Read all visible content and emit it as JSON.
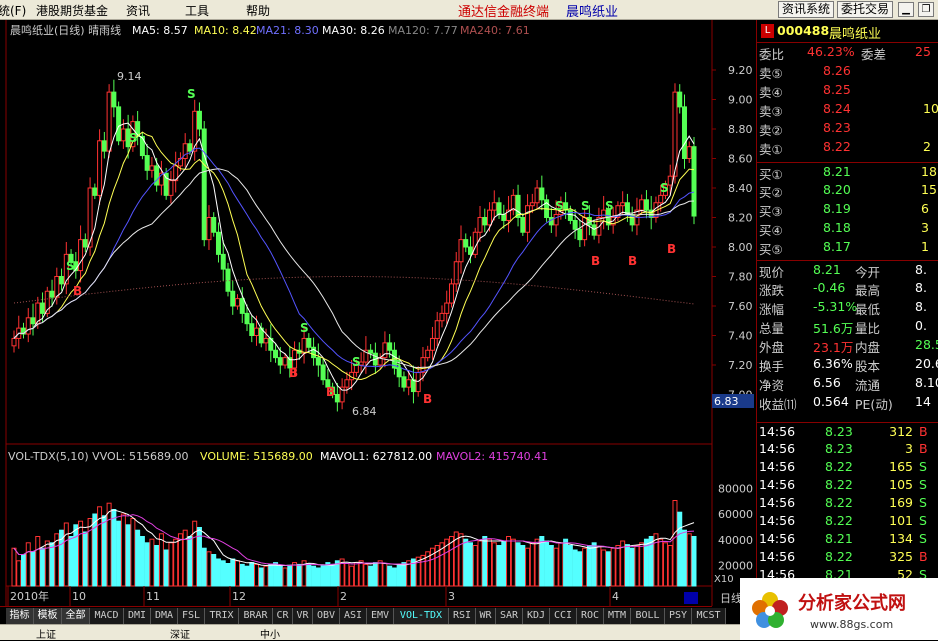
{
  "menu": {
    "item1": "系统(F)",
    "item2": "港股期货基金",
    "item3": "资讯",
    "item4": "工具",
    "item5": "帮助",
    "item6": "通达信金融终端",
    "item7": "晨鸣纸业",
    "btn1": "资讯系统",
    "btn2": "委托交易"
  },
  "chart": {
    "title": "晨鸣纸业(日线) 晴雨线",
    "ma5": "MA5: 8.57",
    "ma10": "MA10: 8.42",
    "ma21": "MA21: 8.30",
    "ma30": "MA30: 8.26",
    "ma120": "MA120: 7.77",
    "ma240": "MA240: 7.61",
    "high_label": "9.14",
    "low_label": "6.84",
    "price_tag": "6.83",
    "price_ticks": [
      "9.20",
      "9.00",
      "8.80",
      "8.60",
      "8.40",
      "8.20",
      "8.00",
      "7.80",
      "7.60",
      "7.40",
      "7.20",
      "7.00"
    ],
    "vol_line": "VOL-TDX(5,10) VVOL: 515689.00",
    "vol_volume": "VOLUME: 515689.00",
    "vol_mavol1": "MAVOL1: 627812.00",
    "vol_mavol2": "MAVOL2: 415740.41",
    "vol_ticks": [
      "80000",
      "60000",
      "40000",
      "20000"
    ],
    "vol_unit": "X10",
    "x_labels": [
      "2010年",
      "10",
      "11",
      "12",
      "2",
      "3",
      "4"
    ],
    "ri_label": "日线"
  },
  "quote": {
    "code": "000488",
    "name": "晨鸣纸业",
    "badge": "L",
    "weibi_label": "委比",
    "weibi": "46.23%",
    "weicha_label": "委差",
    "weicha": "25",
    "asks": [
      {
        "label": "卖⑤",
        "price": "8.26",
        "vol": ""
      },
      {
        "label": "卖④",
        "price": "8.25",
        "vol": ""
      },
      {
        "label": "卖③",
        "price": "8.24",
        "vol": "10"
      },
      {
        "label": "卖②",
        "price": "8.23",
        "vol": ""
      },
      {
        "label": "卖①",
        "price": "8.22",
        "vol": "2"
      }
    ],
    "bids": [
      {
        "label": "买①",
        "price": "8.21",
        "vol": "18"
      },
      {
        "label": "买②",
        "price": "8.20",
        "vol": "15"
      },
      {
        "label": "买③",
        "price": "8.19",
        "vol": "6"
      },
      {
        "label": "买④",
        "price": "8.18",
        "vol": "3"
      },
      {
        "label": "买⑤",
        "price": "8.17",
        "vol": "1"
      }
    ],
    "stats": [
      {
        "l1": "现价",
        "v1": "8.21",
        "l2": "今开",
        "v2": "8."
      },
      {
        "l1": "涨跌",
        "v1": "-0.46",
        "l2": "最高",
        "v2": "8."
      },
      {
        "l1": "涨幅",
        "v1": "-5.31%",
        "l2": "最低",
        "v2": "8."
      },
      {
        "l1": "总量",
        "v1": "51.6万",
        "l2": "量比",
        "v2": "0."
      },
      {
        "l1": "外盘",
        "v1": "23.1万",
        "l2": "内盘",
        "v2": "28.5"
      },
      {
        "l1": "换手",
        "v1": "6.36%",
        "l2": "股本",
        "v2": "20.6"
      },
      {
        "l1": "净资",
        "v1": "6.56",
        "l2": "流通",
        "v2": "8.10"
      },
      {
        "l1": "收益⑾",
        "v1": "0.564",
        "l2": "PE(动)",
        "v2": "14"
      }
    ],
    "ticks": [
      {
        "t": "14:56",
        "p": "8.23",
        "v": "312",
        "d": "B"
      },
      {
        "t": "14:56",
        "p": "8.23",
        "v": "3",
        "d": "B"
      },
      {
        "t": "14:56",
        "p": "8.22",
        "v": "165",
        "d": "S"
      },
      {
        "t": "14:56",
        "p": "8.22",
        "v": "105",
        "d": "S"
      },
      {
        "t": "14:56",
        "p": "8.22",
        "v": "169",
        "d": "S"
      },
      {
        "t": "14:56",
        "p": "8.22",
        "v": "101",
        "d": "S"
      },
      {
        "t": "14:56",
        "p": "8.21",
        "v": "134",
        "d": "S"
      },
      {
        "t": "14:56",
        "p": "8.22",
        "v": "325",
        "d": "B"
      },
      {
        "t": "14:56",
        "p": "8.21",
        "v": "52",
        "d": "S"
      }
    ]
  },
  "tabs": [
    "指标",
    "模板",
    "全部",
    "MACD",
    "DMI",
    "DMA",
    "FSL",
    "TRIX",
    "BRAR",
    "CR",
    "VR",
    "OBV",
    "ASI",
    "EMV",
    "VOL-TDX",
    "RSI",
    "WR",
    "SAR",
    "KDJ",
    "CCI",
    "ROC",
    "MTM",
    "BOLL",
    "PSY",
    "MCST"
  ],
  "status": {
    "s1": "上证",
    "s2": "深证",
    "s3": "中小"
  },
  "logo": {
    "text": "分析家公式网",
    "url": "www.88gs.com"
  },
  "colors": {
    "up": "#ff3232",
    "down": "#54ff54",
    "accent": "#ffff00",
    "ma10": "#ffff54",
    "ma21": "#5454ff",
    "vol_up": "#c00000",
    "vol_down": "#54ffff"
  },
  "chart_data": {
    "type": "candlestick",
    "ylim": [
      6.8,
      9.3
    ],
    "closes": [
      7.38,
      7.45,
      7.41,
      7.52,
      7.48,
      7.62,
      7.55,
      7.7,
      7.66,
      7.8,
      7.75,
      7.95,
      7.9,
      7.84,
      8.05,
      8.0,
      8.4,
      8.35,
      8.72,
      8.65,
      9.05,
      8.95,
      8.72,
      8.8,
      8.68,
      8.85,
      8.75,
      8.62,
      8.52,
      8.55,
      8.42,
      8.5,
      8.35,
      8.45,
      8.55,
      8.6,
      8.7,
      8.65,
      8.92,
      8.8,
      8.05,
      8.2,
      8.1,
      7.95,
      7.85,
      7.7,
      7.6,
      7.65,
      7.55,
      7.48,
      7.4,
      7.45,
      7.35,
      7.38,
      7.3,
      7.25,
      7.2,
      7.25,
      7.18,
      7.3,
      7.28,
      7.38,
      7.32,
      7.25,
      7.2,
      7.1,
      7.05,
      7.0,
      6.95,
      7.05,
      7.1,
      7.15,
      7.2,
      7.22,
      7.3,
      7.28,
      7.2,
      7.25,
      7.35,
      7.3,
      7.18,
      7.12,
      7.05,
      7.1,
      7.02,
      7.15,
      7.25,
      7.3,
      7.38,
      7.5,
      7.55,
      7.62,
      7.75,
      7.9,
      8.05,
      8.0,
      7.95,
      8.1,
      8.2,
      8.15,
      8.25,
      8.3,
      8.22,
      8.18,
      8.25,
      8.35,
      8.2,
      8.1,
      8.28,
      8.3,
      8.4,
      8.32,
      8.2,
      8.15,
      8.22,
      8.3,
      8.25,
      8.18,
      8.12,
      8.05,
      8.2,
      8.15,
      8.08,
      8.2,
      8.25,
      8.15,
      8.2,
      8.28,
      8.3,
      8.22,
      8.15,
      8.25,
      8.32,
      8.25,
      8.2,
      8.3,
      8.35,
      8.42,
      8.48,
      9.05,
      8.95,
      8.6,
      8.68,
      8.21
    ],
    "volumes": [
      42,
      28,
      35,
      48,
      38,
      55,
      42,
      50,
      48,
      58,
      62,
      70,
      55,
      68,
      72,
      60,
      75,
      80,
      88,
      78,
      92,
      85,
      72,
      80,
      68,
      75,
      62,
      55,
      48,
      52,
      45,
      58,
      40,
      48,
      52,
      58,
      62,
      55,
      72,
      65,
      42,
      38,
      35,
      30,
      28,
      25,
      30,
      28,
      24,
      22,
      26,
      24,
      20,
      22,
      24,
      26,
      22,
      20,
      23,
      26,
      24,
      28,
      25,
      22,
      20,
      23,
      26,
      24,
      28,
      30,
      25,
      22,
      26,
      28,
      24,
      22,
      26,
      28,
      25,
      22,
      20,
      24,
      26,
      28,
      30,
      32,
      34,
      38,
      42,
      45,
      48,
      52,
      55,
      60,
      58,
      52,
      48,
      45,
      50,
      55,
      52,
      48,
      45,
      50,
      55,
      52,
      48,
      45,
      42,
      48,
      52,
      55,
      50,
      45,
      42,
      48,
      52,
      45,
      40,
      38,
      42,
      45,
      48,
      44,
      40,
      38,
      42,
      45,
      50,
      46,
      42,
      45,
      48,
      52,
      55,
      58,
      52,
      48,
      45,
      95,
      82,
      62,
      58,
      55
    ]
  }
}
